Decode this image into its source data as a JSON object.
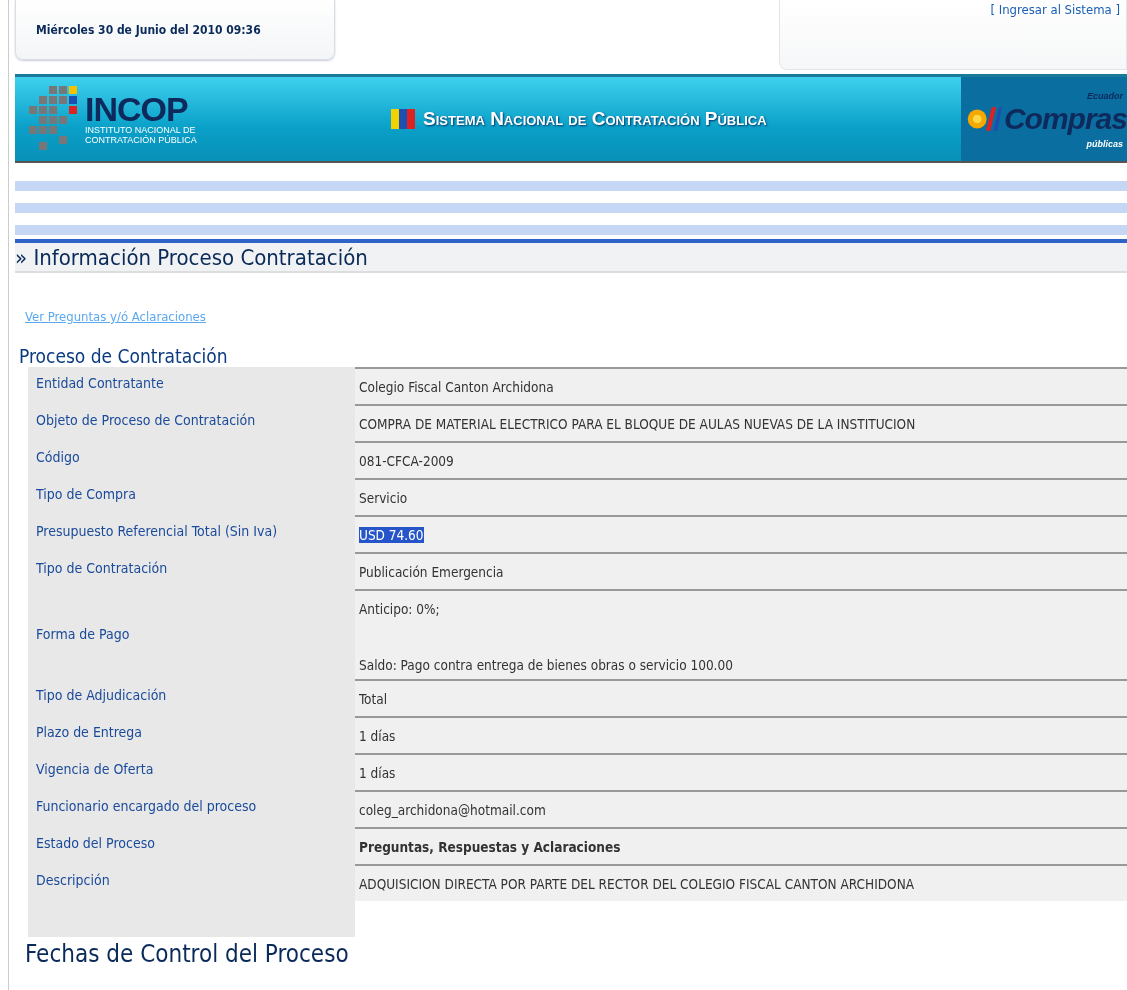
{
  "header": {
    "datetime": "Miércoles 30 de Junio del 2010 09:36",
    "login_link": "[ Ingresar al Sistema ]"
  },
  "banner": {
    "logo_left": {
      "name": "INCOP",
      "line_1": "INSTITUTO NACIONAL DE",
      "line_2": "CONTRATACIÓN PÚBLICA"
    },
    "title": "Sistema Nacional de Contratación Pública",
    "logo_right": {
      "top": "Ecuador",
      "name": "Compras",
      "bottom": "públicas"
    }
  },
  "page_title": "» Información Proceso Contratación",
  "questions_link": "Ver Preguntas y/ó Aclaraciones",
  "section_title": "Proceso de Contratación",
  "rows": [
    {
      "label": "Entidad Contratante",
      "values": [
        "Colegio Fiscal Canton Archidona"
      ],
      "bold": false,
      "highlighted": false
    },
    {
      "label": "Objeto de Proceso de Contratación",
      "values": [
        "COMPRA DE MATERIAL ELECTRICO PARA EL BLOQUE DE AULAS NUEVAS DE LA INSTITUCION"
      ],
      "bold": false,
      "highlighted": false
    },
    {
      "label": "Código",
      "values": [
        "081-CFCA-2009"
      ],
      "bold": false,
      "highlighted": false
    },
    {
      "label": "Tipo de Compra",
      "values": [
        "Servicio"
      ],
      "bold": false,
      "highlighted": false
    },
    {
      "label": "Presupuesto Referencial Total (Sin Iva)",
      "values": [
        "USD 74.60"
      ],
      "bold": false,
      "highlighted": true
    },
    {
      "label": "Tipo de Contratación",
      "values": [
        "Publicación Emergencia"
      ],
      "bold": false,
      "highlighted": false
    },
    {
      "label": "Forma de Pago",
      "values": [
        "Anticipo: 0%;",
        "Saldo: Pago contra entrega de bienes obras o servicio 100.00"
      ],
      "bold": false,
      "highlighted": false
    },
    {
      "label": "Tipo de Adjudicación",
      "values": [
        "Total"
      ],
      "bold": false,
      "highlighted": false
    },
    {
      "label": "Plazo de Entrega",
      "values": [
        "1 días"
      ],
      "bold": false,
      "highlighted": false
    },
    {
      "label": "Vigencia de Oferta",
      "values": [
        "1 días"
      ],
      "bold": false,
      "highlighted": false
    },
    {
      "label": "Funcionario encargado del proceso",
      "values": [
        "coleg_archidona@hotmail.com"
      ],
      "bold": false,
      "highlighted": false
    },
    {
      "label": "Estado del Proceso",
      "values": [
        "Preguntas, Respuestas y Aclaraciones"
      ],
      "bold": true,
      "highlighted": false
    },
    {
      "label": "Descripción",
      "values": [
        "ADQUISICION DIRECTA POR PARTE DEL RECTOR DEL COLEGIO FISCAL CANTON ARCHIDONA"
      ],
      "bold": false,
      "highlighted": false
    }
  ],
  "next_section_title": "Fechas de Control del Proceso"
}
